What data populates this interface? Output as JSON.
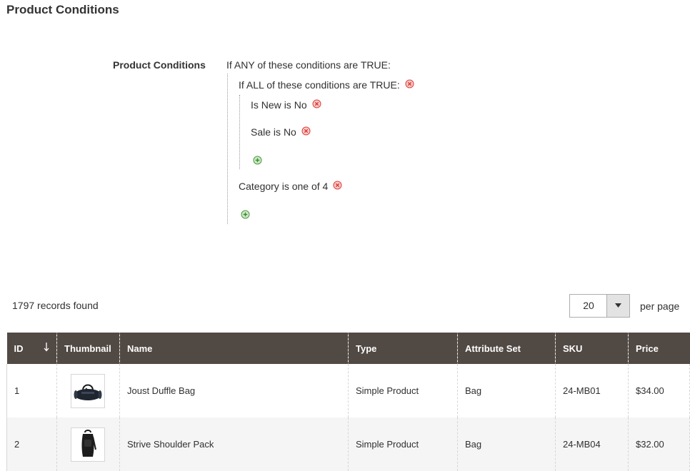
{
  "page": {
    "title": "Product Conditions"
  },
  "conditions": {
    "field_label": "Product Conditions",
    "root": {
      "prefix": "If",
      "aggregator": "ANY",
      "mid": "of these conditions are",
      "value": "TRUE",
      "suffix": ":"
    },
    "group": {
      "prefix": "If",
      "aggregator": "ALL",
      "mid": "of these conditions are",
      "value": "TRUE",
      "suffix": ":"
    },
    "group_rules": [
      {
        "attribute": "Is New",
        "operator": "is",
        "value": "No"
      },
      {
        "attribute": "Sale",
        "operator": "is",
        "value": "No"
      }
    ],
    "root_rules": [
      {
        "attribute": "Category",
        "operator": "is one of",
        "value": "4"
      }
    ],
    "icons": {
      "remove": "remove-icon",
      "add": "add-icon"
    },
    "colors": {
      "remove": "#e0403a",
      "add": "#4a9a3e"
    }
  },
  "grid_toolbar": {
    "records_found": "1797 records found",
    "per_page_value": "20",
    "per_page_label": "per page"
  },
  "grid": {
    "header_bg": "#514943",
    "columns": [
      "ID",
      "Thumbnail",
      "Name",
      "Type",
      "Attribute Set",
      "SKU",
      "Price"
    ],
    "sort_icon": "arrow-down-icon",
    "rows": [
      {
        "id": "1",
        "thumbnail": "duffle-bag-thumbnail",
        "name": "Joust Duffle Bag",
        "type": "Simple Product",
        "attribute_set": "Bag",
        "sku": "24-MB01",
        "price": "$34.00"
      },
      {
        "id": "2",
        "thumbnail": "shoulder-pack-thumbnail",
        "name": "Strive Shoulder Pack",
        "type": "Simple Product",
        "attribute_set": "Bag",
        "sku": "24-MB04",
        "price": "$32.00"
      }
    ]
  }
}
